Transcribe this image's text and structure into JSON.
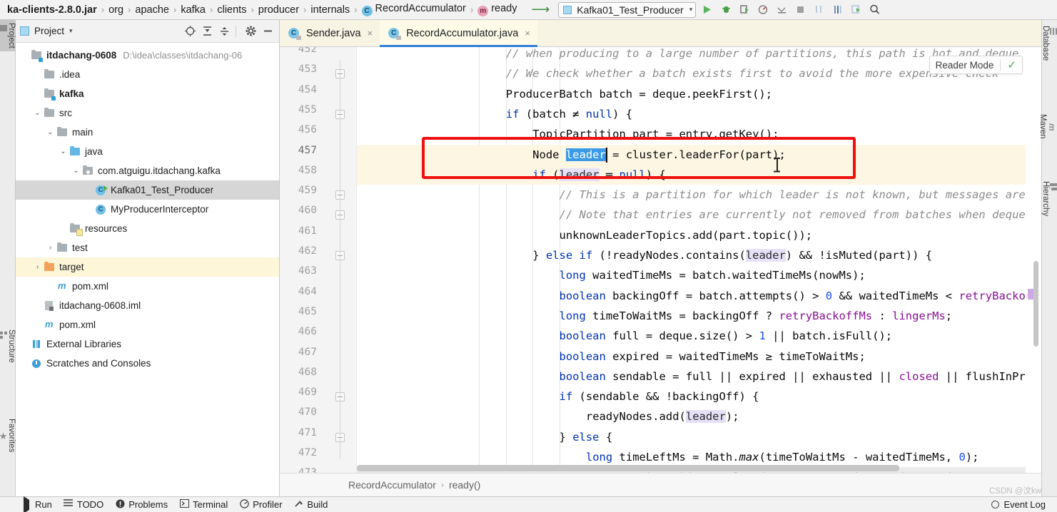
{
  "topbar": {
    "breadcrumbs": [
      {
        "label": "ka-clients-2.8.0.jar",
        "icon": "",
        "root": true
      },
      {
        "label": "org",
        "icon": ""
      },
      {
        "label": "apache",
        "icon": ""
      },
      {
        "label": "kafka",
        "icon": ""
      },
      {
        "label": "clients",
        "icon": ""
      },
      {
        "label": "producer",
        "icon": ""
      },
      {
        "label": "internals",
        "icon": ""
      },
      {
        "label": "RecordAccumulator",
        "icon": "class-icon",
        "badge": "C"
      },
      {
        "label": "ready",
        "icon": "method-icon",
        "badge": "m"
      }
    ],
    "separator": "›",
    "run_config": {
      "name": "Kafka01_Test_Producer",
      "chevron": "▾"
    },
    "icon_names": [
      "run-icon",
      "debug-icon",
      "coverage-icon",
      "profile-icon",
      "attach-icon",
      "stop-icon",
      "git-update-icon",
      "commit-icon",
      "search-everywhere-icon"
    ]
  },
  "left_tool_strip": {
    "tabs": [
      {
        "label": "Project",
        "icon": "project-folder-icon",
        "selected": true
      },
      {
        "label": "Structure",
        "icon": "structure-icon",
        "selected": false
      },
      {
        "label": "Favorites",
        "icon": "star-icon",
        "selected": false
      }
    ]
  },
  "right_tool_strip": {
    "tabs": [
      {
        "label": "Database",
        "icon": "database-icon"
      },
      {
        "label": "Maven",
        "icon": "maven-icon"
      },
      {
        "label": "Hierarchy",
        "icon": "hierarchy-icon"
      }
    ]
  },
  "project_panel": {
    "title": "Project",
    "chevron": "▾",
    "toolbar_icons": [
      "locate-icon",
      "expand-all-icon",
      "collapse-all-icon",
      "gear-icon",
      "hide-icon"
    ],
    "tree": [
      {
        "indent": 0,
        "arrow": "",
        "icon": "module-icon",
        "label": "itdachang-0608",
        "bold": true,
        "path": "D:\\idea\\classes\\itdachang-06",
        "state": "normal"
      },
      {
        "indent": 1,
        "arrow": "",
        "icon": "folder-gray",
        "label": ".idea",
        "bold": false,
        "path": "",
        "state": "normal"
      },
      {
        "indent": 1,
        "arrow": "",
        "icon": "module-icon",
        "label": "kafka",
        "bold": true,
        "path": "",
        "state": "normal"
      },
      {
        "indent": 1,
        "arrow": "⌄",
        "icon": "folder-gray",
        "label": "src",
        "bold": false,
        "path": "",
        "state": "normal"
      },
      {
        "indent": 2,
        "arrow": "⌄",
        "icon": "folder-gray",
        "label": "main",
        "bold": false,
        "path": "",
        "state": "normal"
      },
      {
        "indent": 3,
        "arrow": "⌄",
        "icon": "folder-blue",
        "label": "java",
        "bold": false,
        "path": "",
        "state": "normal"
      },
      {
        "indent": 4,
        "arrow": "⌄",
        "icon": "package-icon",
        "label": "com.atguigu.itdachang.kafka",
        "bold": false,
        "path": "",
        "state": "normal"
      },
      {
        "indent": 5,
        "arrow": "",
        "icon": "class-run-icon",
        "label": "Kafka01_Test_Producer",
        "bold": false,
        "path": "",
        "state": "selected"
      },
      {
        "indent": 5,
        "arrow": "",
        "icon": "class-icon",
        "label": "MyProducerInterceptor",
        "bold": false,
        "path": "",
        "state": "normal"
      },
      {
        "indent": 3,
        "arrow": "",
        "icon": "resources-icon",
        "label": "resources",
        "bold": false,
        "path": "",
        "state": "normal"
      },
      {
        "indent": 2,
        "arrow": "›",
        "icon": "folder-gray",
        "label": "test",
        "bold": false,
        "path": "",
        "state": "normal"
      },
      {
        "indent": 1,
        "arrow": "›",
        "icon": "folder-orange",
        "label": "target",
        "bold": false,
        "path": "",
        "state": "highlighted"
      },
      {
        "indent": 2,
        "arrow": "",
        "icon": "maven-file-icon",
        "label": "pom.xml",
        "bold": false,
        "path": "",
        "state": "normal"
      },
      {
        "indent": 1,
        "arrow": "",
        "icon": "iml-file-icon",
        "label": "itdachang-0608.iml",
        "bold": false,
        "path": "",
        "state": "normal"
      },
      {
        "indent": 1,
        "arrow": "",
        "icon": "maven-file-icon",
        "label": "pom.xml",
        "bold": false,
        "path": "",
        "state": "normal"
      },
      {
        "indent": 0,
        "arrow": "",
        "icon": "library-icon",
        "label": "External Libraries",
        "bold": false,
        "path": "",
        "state": "normal"
      },
      {
        "indent": 0,
        "arrow": "",
        "icon": "scratch-icon",
        "label": "Scratches and Consoles",
        "bold": false,
        "path": "",
        "state": "normal"
      }
    ]
  },
  "editor": {
    "tabs": [
      {
        "label": "Sender.java",
        "icon": "java-class-icon",
        "close": "×",
        "active": false
      },
      {
        "label": "RecordAccumulator.java",
        "icon": "java-class-icon",
        "close": "×",
        "active": true
      }
    ],
    "reader_mode": {
      "label": "Reader Mode",
      "check": "✓"
    },
    "first_line_number": 452,
    "last_line_number": 473,
    "current_line": 457,
    "breadcrumb": {
      "class": "RecordAccumulator",
      "method": "ready()",
      "sep": "›"
    },
    "lines": [
      {
        "n": 452,
        "indent": 5,
        "segments": [
          {
            "t": "// when producing to a large number of partitions, this path is hot and deque",
            "c": "cm"
          }
        ]
      },
      {
        "n": 453,
        "indent": 5,
        "segments": [
          {
            "t": "// We check whether a batch exists first to avoid the mor",
            "c": "cm"
          },
          {
            "t": "e expensive check",
            "c": "cm"
          }
        ]
      },
      {
        "n": 454,
        "indent": 5,
        "segments": [
          {
            "t": "ProducerBatch batch = deque.peekFirst();",
            "c": "txt"
          }
        ]
      },
      {
        "n": 455,
        "indent": 5,
        "segments": [
          {
            "t": "if",
            "c": "kw"
          },
          {
            "t": " (batch ≠ ",
            "c": "txt"
          },
          {
            "t": "null",
            "c": "kw"
          },
          {
            "t": ") {",
            "c": "txt"
          }
        ]
      },
      {
        "n": 456,
        "indent": 6,
        "segments": [
          {
            "t": "TopicPartition part = entry.getKey();",
            "c": "txt"
          }
        ]
      },
      {
        "n": 457,
        "indent": 6,
        "segments": [
          {
            "t": "Node ",
            "c": "txt"
          },
          {
            "t": "leader",
            "c": "sel-blue"
          },
          {
            "t": " = cluster.leaderFor(part);",
            "c": "txt"
          }
        ]
      },
      {
        "n": 458,
        "indent": 6,
        "segments": [
          {
            "t": "if",
            "c": "kw"
          },
          {
            "t": " (",
            "c": "txt"
          },
          {
            "t": "leader",
            "c": "occ"
          },
          {
            "t": " ═ ",
            "c": "txt"
          },
          {
            "t": "null",
            "c": "kw"
          },
          {
            "t": ") {",
            "c": "txt"
          }
        ]
      },
      {
        "n": 459,
        "indent": 7,
        "segments": [
          {
            "t": "// This is a partition for which leader is not known, but messages are available to send.",
            "c": "cm"
          }
        ]
      },
      {
        "n": 460,
        "indent": 7,
        "segments": [
          {
            "t": "// Note that entries are currently not removed from batches when deque is empty.",
            "c": "cm"
          }
        ]
      },
      {
        "n": 461,
        "indent": 7,
        "segments": [
          {
            "t": "unknownLeaderTopics.add(part.topic());",
            "c": "txt"
          }
        ]
      },
      {
        "n": 462,
        "indent": 6,
        "segments": [
          {
            "t": "} ",
            "c": "txt"
          },
          {
            "t": "else if",
            "c": "kw"
          },
          {
            "t": " (!readyNodes.contains(",
            "c": "txt"
          },
          {
            "t": "leader",
            "c": "occ"
          },
          {
            "t": ") && !isMuted(part)) {",
            "c": "txt"
          }
        ]
      },
      {
        "n": 463,
        "indent": 7,
        "segments": [
          {
            "t": "long",
            "c": "kw"
          },
          {
            "t": " waitedTimeMs = batch.waitedTimeMs(nowMs);",
            "c": "txt"
          }
        ]
      },
      {
        "n": 464,
        "indent": 7,
        "segments": [
          {
            "t": "boolean",
            "c": "kw"
          },
          {
            "t": " backingOff = batch.attempts() > ",
            "c": "txt"
          },
          {
            "t": "0",
            "c": "num"
          },
          {
            "t": " && waitedTimeMs < ",
            "c": "txt"
          },
          {
            "t": "retryBackoffMs;",
            "c": "fld"
          }
        ]
      },
      {
        "n": 465,
        "indent": 7,
        "segments": [
          {
            "t": "long",
            "c": "kw"
          },
          {
            "t": " timeToWaitMs = backingOff ? ",
            "c": "txt"
          },
          {
            "t": "retryBackoffMs",
            "c": "fld"
          },
          {
            "t": " : ",
            "c": "txt"
          },
          {
            "t": "lingerMs",
            "c": "fld"
          },
          {
            "t": ";",
            "c": "txt"
          }
        ]
      },
      {
        "n": 466,
        "indent": 7,
        "segments": [
          {
            "t": "boolean",
            "c": "kw"
          },
          {
            "t": " full = deque.size() > ",
            "c": "txt"
          },
          {
            "t": "1",
            "c": "num"
          },
          {
            "t": " || batch.isFull();",
            "c": "txt"
          }
        ]
      },
      {
        "n": 467,
        "indent": 7,
        "segments": [
          {
            "t": "boolean",
            "c": "kw"
          },
          {
            "t": " expired = waitedTimeMs ≥ timeToWaitMs;",
            "c": "txt"
          }
        ]
      },
      {
        "n": 468,
        "indent": 7,
        "segments": [
          {
            "t": "boolean",
            "c": "kw"
          },
          {
            "t": " sendable = full || expired || exhausted || ",
            "c": "txt"
          },
          {
            "t": "closed",
            "c": "fld"
          },
          {
            "t": " || flushInProgress();",
            "c": "txt"
          }
        ]
      },
      {
        "n": 469,
        "indent": 7,
        "segments": [
          {
            "t": "if",
            "c": "kw"
          },
          {
            "t": " (sendable && !backingOff) {",
            "c": "txt"
          }
        ]
      },
      {
        "n": 470,
        "indent": 8,
        "segments": [
          {
            "t": "readyNodes.add(",
            "c": "txt"
          },
          {
            "t": "leader",
            "c": "occ"
          },
          {
            "t": ");",
            "c": "txt"
          }
        ]
      },
      {
        "n": 471,
        "indent": 7,
        "segments": [
          {
            "t": "} ",
            "c": "txt"
          },
          {
            "t": "else",
            "c": "kw"
          },
          {
            "t": " {",
            "c": "txt"
          }
        ]
      },
      {
        "n": 472,
        "indent": 8,
        "segments": [
          {
            "t": "long",
            "c": "kw"
          },
          {
            "t": " timeLeftMs = Math.",
            "c": "txt"
          },
          {
            "t": "max",
            "c": "mi"
          },
          {
            "t": "(timeToWaitMs - waitedTimeMs, ",
            "c": "txt"
          },
          {
            "t": "0",
            "c": "num"
          },
          {
            "t": ");",
            "c": "txt"
          }
        ]
      },
      {
        "n": 473,
        "indent": 8,
        "segments": [
          {
            "t": "// Note that this results in a conservative estimate since an",
            "c": "cm"
          }
        ]
      }
    ]
  },
  "status_bar": {
    "items": [
      {
        "label": "Run",
        "icon": "run-icon"
      },
      {
        "label": "TODO",
        "icon": "todo-icon"
      },
      {
        "label": "Problems",
        "icon": "problems-icon"
      },
      {
        "label": "Terminal",
        "icon": "terminal-icon"
      },
      {
        "label": "Profiler",
        "icon": "profiler-icon"
      },
      {
        "label": "Build",
        "icon": "build-icon"
      }
    ],
    "event_log": {
      "label": "Event Log",
      "icon": "event-log-icon"
    }
  },
  "watermark": "CSDN @汶kw",
  "colors": {
    "accent": "#2d7fd3",
    "selection": "#3a9ae8",
    "occurrence": "#e6e1f7",
    "keyword": "#0033b3",
    "comment": "#8c8c8c",
    "field": "#871094",
    "number": "#1750eb",
    "annotation_box": "#f01010",
    "current_line": "#fdf6e3",
    "target_folder": "#fdf6d8"
  }
}
